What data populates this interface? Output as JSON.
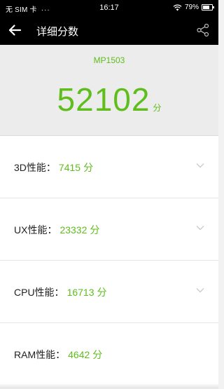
{
  "status_bar": {
    "carrier": "无 SIM 卡",
    "dots": "···",
    "time": "16:17",
    "battery_percent": "79%",
    "battery_level": 0.79
  },
  "app_bar": {
    "title": "详细分数",
    "back_icon": "arrow-left-icon",
    "share_icon": "share-icon"
  },
  "summary": {
    "device": "MP1503",
    "total_score": "52102",
    "unit": "分"
  },
  "rows": [
    {
      "label": "3D性能：",
      "value": "7415",
      "unit": "分"
    },
    {
      "label": "UX性能：",
      "value": "23332",
      "unit": "分"
    },
    {
      "label": "CPU性能：",
      "value": "16713",
      "unit": "分"
    },
    {
      "label": "RAM性能：",
      "value": "4642",
      "unit": "分"
    }
  ],
  "colors": {
    "accent": "#5fbd1c",
    "header_bg": "#ececec",
    "bar_bg": "#000000"
  }
}
